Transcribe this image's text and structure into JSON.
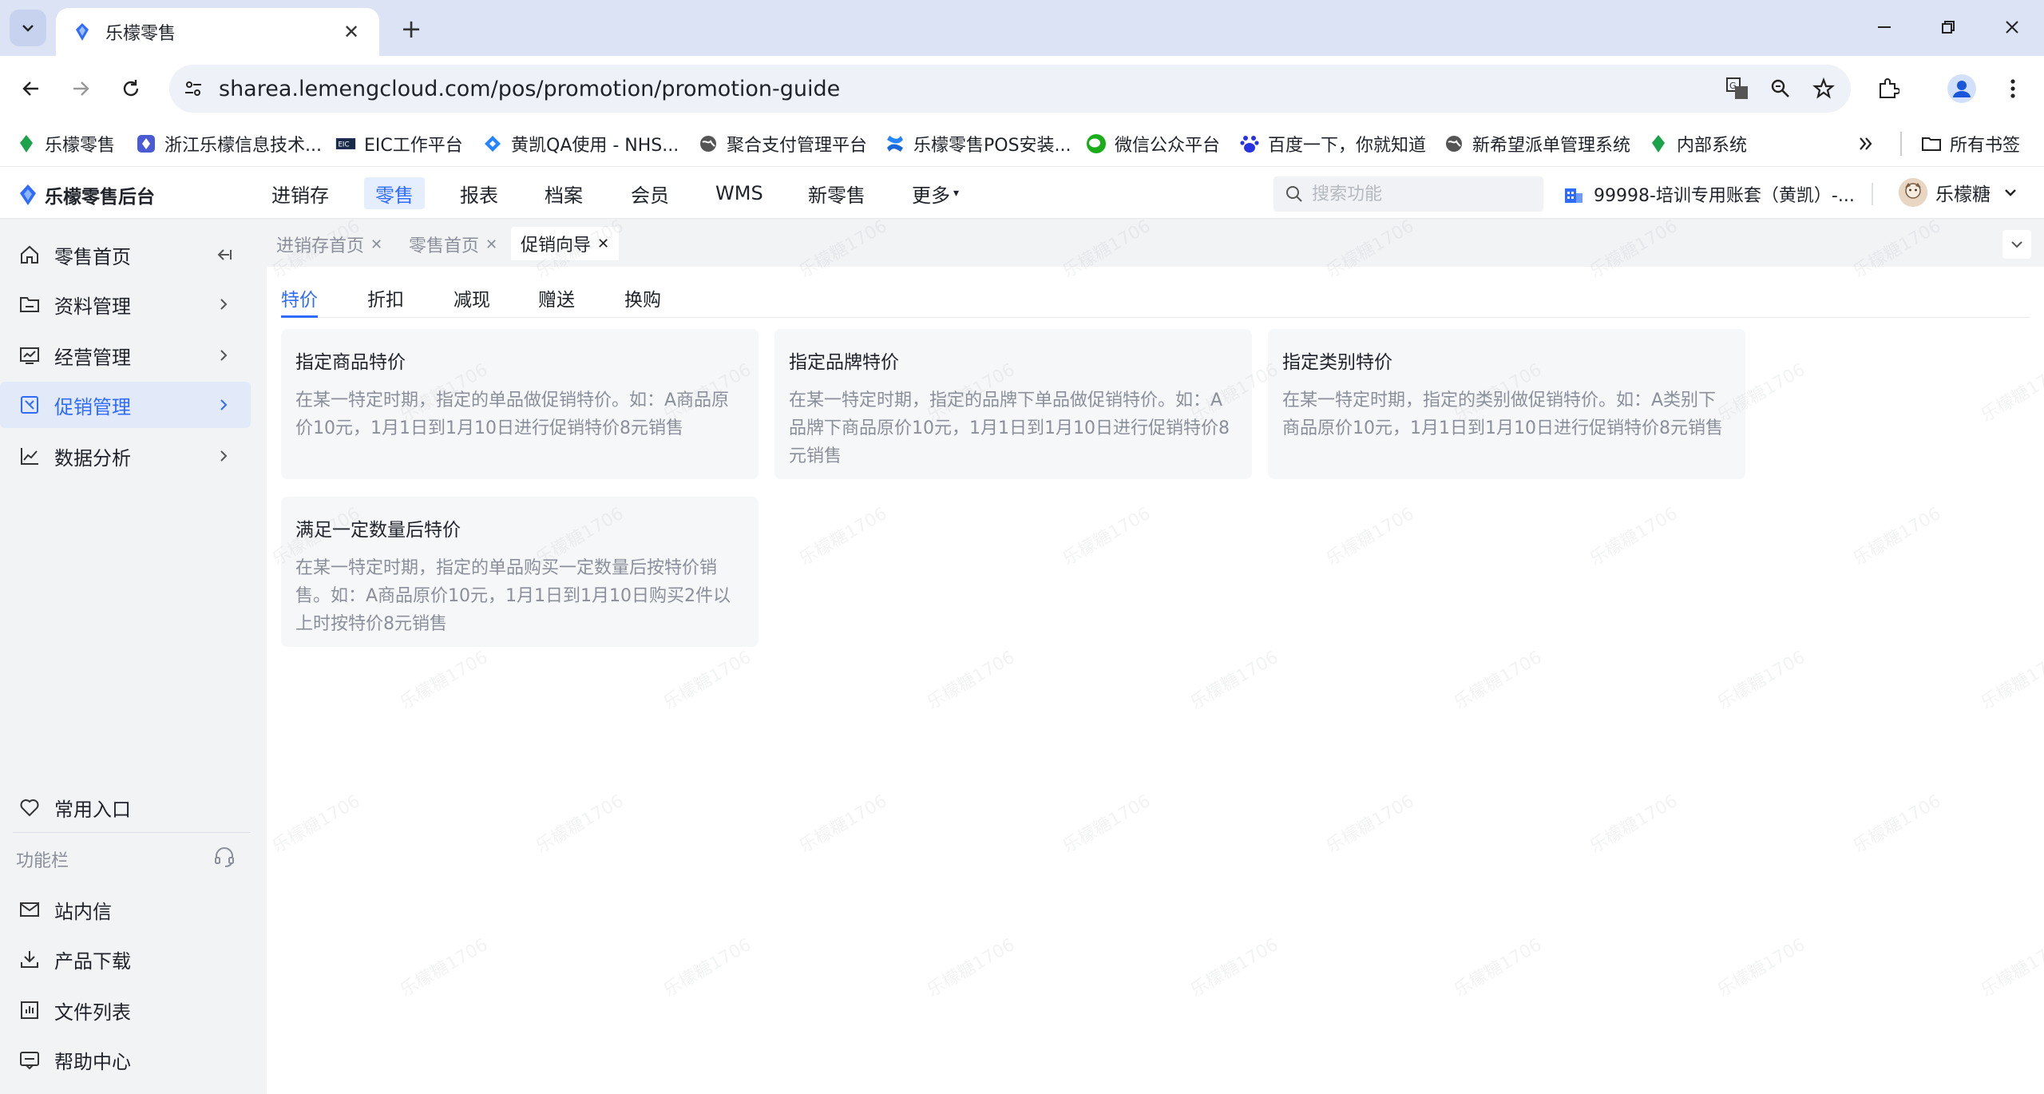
{
  "browser": {
    "tab_title": "乐檬零售",
    "url": "sharea.lemengcloud.com/pos/promotion/promotion-guide",
    "bookmarks": [
      {
        "label": "乐檬零售",
        "icon": "lemon-icon"
      },
      {
        "label": "浙江乐檬信息技术...",
        "icon": "diamond-icon"
      },
      {
        "label": "EIC工作平台",
        "icon": "eic-icon"
      },
      {
        "label": "黄凯QA使用 - NHS...",
        "icon": "jira-icon"
      },
      {
        "label": "聚合支付管理平台",
        "icon": "globe-icon"
      },
      {
        "label": "乐檬零售POS安装...",
        "icon": "confluence-icon"
      },
      {
        "label": "微信公众平台",
        "icon": "wechat-icon"
      },
      {
        "label": "百度一下，你就知道",
        "icon": "baidu-icon"
      },
      {
        "label": "新希望派单管理系统",
        "icon": "globe-icon"
      },
      {
        "label": "内部系统",
        "icon": "lemon-icon"
      }
    ],
    "all_bookmarks_label": "所有书签"
  },
  "app": {
    "brand": "乐檬零售后台",
    "nav": [
      "进销存",
      "零售",
      "报表",
      "档案",
      "会员",
      "WMS",
      "新零售",
      "更多"
    ],
    "active_nav": "零售",
    "search_placeholder": "搜索功能",
    "account": "99998-培训专用账套（黄凯）-...",
    "user": "乐檬糖"
  },
  "sidebar": {
    "items": [
      {
        "label": "零售首页",
        "icon": "home-icon"
      },
      {
        "label": "资料管理",
        "icon": "folder-icon"
      },
      {
        "label": "经营管理",
        "icon": "monitor-chart-icon"
      },
      {
        "label": "促销管理",
        "icon": "promotion-icon"
      },
      {
        "label": "数据分析",
        "icon": "line-chart-icon"
      }
    ],
    "active": "促销管理",
    "favorites": "常用入口",
    "section_label": "功能栏",
    "bottom_items": [
      {
        "label": "站内信",
        "icon": "mail-icon"
      },
      {
        "label": "产品下载",
        "icon": "download-icon"
      },
      {
        "label": "文件列表",
        "icon": "bar-chart-icon"
      },
      {
        "label": "帮助中心",
        "icon": "help-icon"
      }
    ]
  },
  "page_tabs": [
    "进销存首页",
    "零售首页",
    "促销向导"
  ],
  "active_page_tab": "促销向导",
  "sub_tabs": [
    "特价",
    "折扣",
    "减现",
    "赠送",
    "换购"
  ],
  "active_sub_tab": "特价",
  "cards": [
    {
      "title": "指定商品特价",
      "desc": "在某一特定时期，指定的单品做促销特价。如：A商品原价10元，1月1日到1月10日进行促销特价8元销售"
    },
    {
      "title": "指定品牌特价",
      "desc": "在某一特定时期，指定的品牌下单品做促销特价。如：A品牌下商品原价10元，1月1日到1月10日进行促销特价8元销售"
    },
    {
      "title": "指定类别特价",
      "desc": "在某一特定时期，指定的类别做促销特价。如：A类别下商品原价10元，1月1日到1月10日进行促销特价8元销售"
    },
    {
      "title": "满足一定数量后特价",
      "desc": "在某一特定时期，指定的单品购买一定数量后按特价销售。如：A商品原价10元，1月1日到1月10日购买2件以上时按特价8元销售"
    }
  ],
  "watermark_text": "乐檬糖1706",
  "colors": {
    "accent": "#2f6bff",
    "sidebar_bg": "#f2f3f5",
    "card_bg": "#f6f7f9"
  }
}
